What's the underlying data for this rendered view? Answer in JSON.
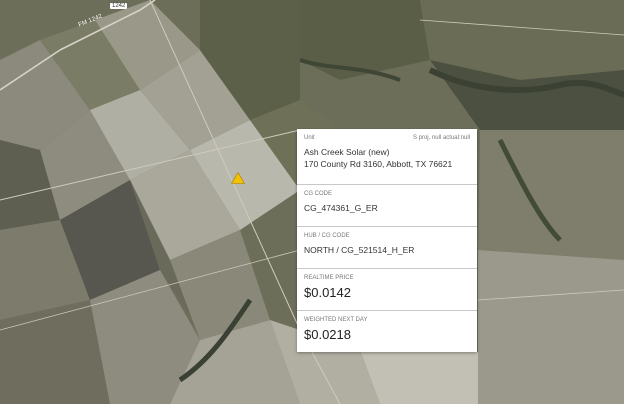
{
  "map": {
    "road_shield": "1242",
    "road_label": "FM 1242",
    "marker_color": "#f2c200",
    "marker_icon": "warning-triangle"
  },
  "panel": {
    "unit_label": "Unit",
    "unit_meta": "S proj, null actual:null",
    "unit_name": "Ash Creek Solar (new)",
    "unit_address": "170 County Rd 3160, Abbott, TX 76621",
    "cg_code_label": "CG CODE",
    "cg_code_value": "CG_474361_G_ER",
    "hub_label": "HUB / CG CODE",
    "hub_value": "NORTH / CG_521514_H_ER",
    "realtime_label": "REALTIME PRICE",
    "realtime_value": "$0.0142",
    "weighted_label": "WEIGHTED NEXT DAY",
    "weighted_value": "$0.0218"
  }
}
